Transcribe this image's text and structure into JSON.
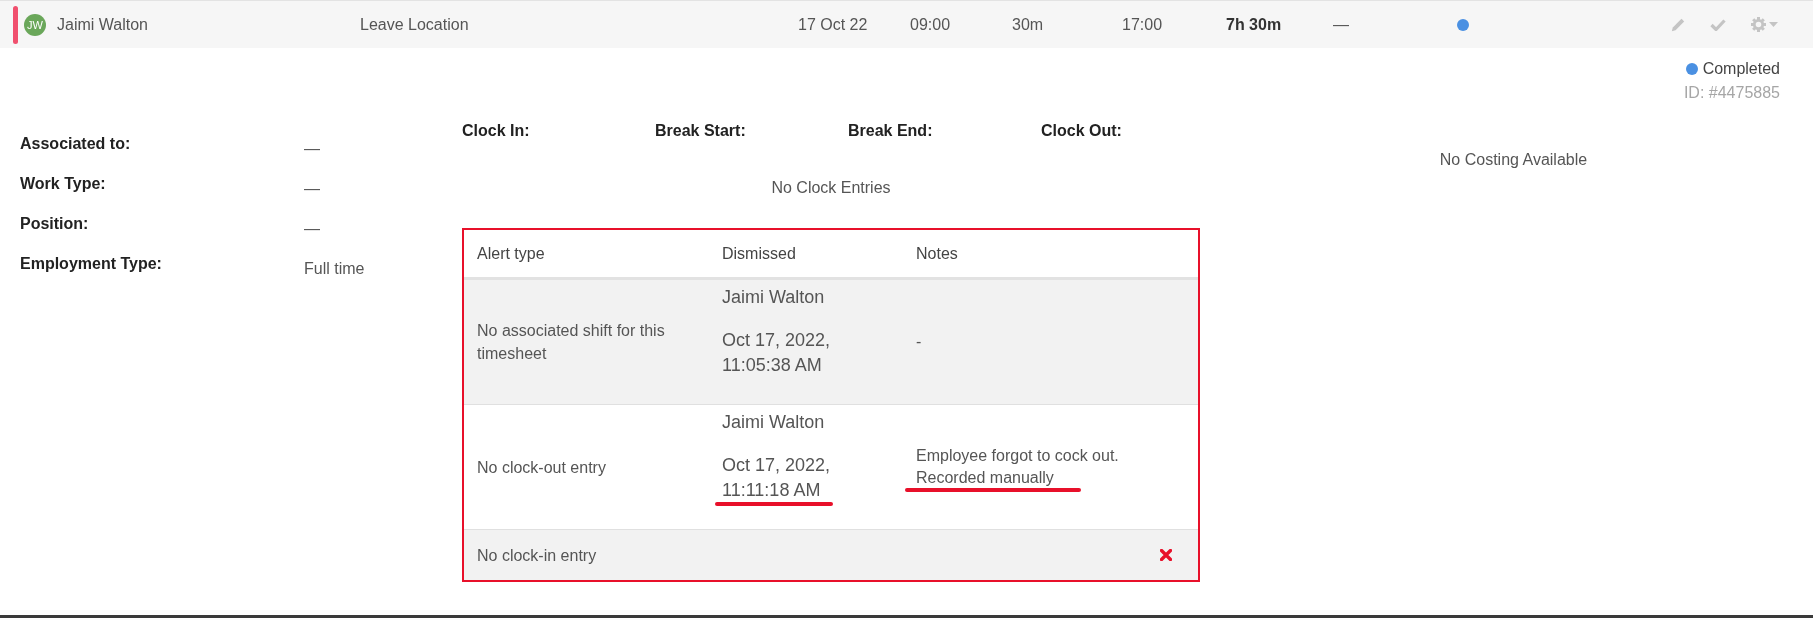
{
  "shift_row": {
    "has_alerts": true,
    "employee": {
      "initials": "JW",
      "name": "Jaimi Walton"
    },
    "location": "Leave Location",
    "date": "17 Oct 22",
    "clock_in": "09:00",
    "break": "30m",
    "clock_out": "17:00",
    "total": "7h 30m",
    "column_8": "—",
    "status": {
      "color": "#4a90e2"
    }
  },
  "status": {
    "label": "Completed",
    "color": "#4a90e2",
    "id": "ID: #4475885"
  },
  "details": [
    {
      "label": "Associated to:",
      "value": "—"
    },
    {
      "label": "Work Type:",
      "value": "—"
    },
    {
      "label": "Position:",
      "value": "—"
    },
    {
      "label": "Employment Type:",
      "value": "Full time"
    }
  ],
  "clock_entries": {
    "columns": [
      "Clock In:",
      "Break Start:",
      "Break End:",
      "Clock Out:"
    ],
    "empty_message": "No Clock Entries"
  },
  "alerts": {
    "outlined": true,
    "columns": [
      "Alert type",
      "Dismissed",
      "Notes"
    ],
    "rows": [
      {
        "alert_type": "No associated shift for this timesheet",
        "dismissed": true,
        "dismissed_by": "Jaimi Walton",
        "dismissed_at": "Oct 17, 2022, 11:05:38 AM",
        "notes": "-",
        "time_marked": false,
        "notes_marked": false
      },
      {
        "alert_type": "No clock-out entry",
        "dismissed": true,
        "dismissed_by": "Jaimi Walton",
        "dismissed_at": "Oct 17, 2022, 11:11:18 AM",
        "notes": "Employee forgot to cock out. Recorded manually",
        "time_marked": true,
        "notes_marked": true
      },
      {
        "alert_type": "No clock-in entry",
        "dismissed": false
      }
    ]
  },
  "costing": {
    "message": "No Costing Available"
  }
}
